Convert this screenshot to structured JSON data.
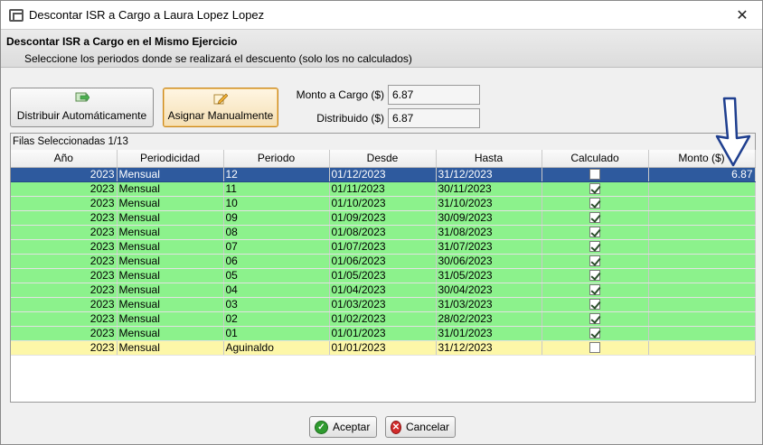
{
  "window": {
    "title": "Descontar ISR a Cargo a Laura Lopez Lopez",
    "close_glyph": "✕"
  },
  "header": {
    "title": "Descontar ISR a Cargo en el Mismo Ejercicio",
    "subtitle": "Seleccione los periodos donde se realizará el descuento (solo los no calculados)"
  },
  "toolbar": {
    "auto_label": "Distribuir Automáticamente",
    "manual_label": "Asignar Manualmente"
  },
  "fields": {
    "monto_label": "Monto a Cargo ($)",
    "monto_value": "6.87",
    "distribuido_label": "Distribuido ($)",
    "distribuido_value": "6.87"
  },
  "grid": {
    "caption": "Filas Seleccionadas  1/13",
    "columns": [
      "Año",
      "Periodicidad",
      "Periodo",
      "Desde",
      "Hasta",
      "Calculado",
      "Monto ($)"
    ],
    "rows": [
      {
        "anio": "2023",
        "periodicidad": "Mensual",
        "periodo": "12",
        "desde": "01/12/2023",
        "hasta": "31/12/2023",
        "calculado": false,
        "monto": "6.87",
        "state": "selected"
      },
      {
        "anio": "2023",
        "periodicidad": "Mensual",
        "periodo": "11",
        "desde": "01/11/2023",
        "hasta": "30/11/2023",
        "calculado": true,
        "monto": "",
        "state": "calculated"
      },
      {
        "anio": "2023",
        "periodicidad": "Mensual",
        "periodo": "10",
        "desde": "01/10/2023",
        "hasta": "31/10/2023",
        "calculado": true,
        "monto": "",
        "state": "calculated"
      },
      {
        "anio": "2023",
        "periodicidad": "Mensual",
        "periodo": "09",
        "desde": "01/09/2023",
        "hasta": "30/09/2023",
        "calculado": true,
        "monto": "",
        "state": "calculated"
      },
      {
        "anio": "2023",
        "periodicidad": "Mensual",
        "periodo": "08",
        "desde": "01/08/2023",
        "hasta": "31/08/2023",
        "calculado": true,
        "monto": "",
        "state": "calculated"
      },
      {
        "anio": "2023",
        "periodicidad": "Mensual",
        "periodo": "07",
        "desde": "01/07/2023",
        "hasta": "31/07/2023",
        "calculado": true,
        "monto": "",
        "state": "calculated"
      },
      {
        "anio": "2023",
        "periodicidad": "Mensual",
        "periodo": "06",
        "desde": "01/06/2023",
        "hasta": "30/06/2023",
        "calculado": true,
        "monto": "",
        "state": "calculated"
      },
      {
        "anio": "2023",
        "periodicidad": "Mensual",
        "periodo": "05",
        "desde": "01/05/2023",
        "hasta": "31/05/2023",
        "calculado": true,
        "monto": "",
        "state": "calculated"
      },
      {
        "anio": "2023",
        "periodicidad": "Mensual",
        "periodo": "04",
        "desde": "01/04/2023",
        "hasta": "30/04/2023",
        "calculado": true,
        "monto": "",
        "state": "calculated"
      },
      {
        "anio": "2023",
        "periodicidad": "Mensual",
        "periodo": "03",
        "desde": "01/03/2023",
        "hasta": "31/03/2023",
        "calculado": true,
        "monto": "",
        "state": "calculated"
      },
      {
        "anio": "2023",
        "periodicidad": "Mensual",
        "periodo": "02",
        "desde": "01/02/2023",
        "hasta": "28/02/2023",
        "calculado": true,
        "monto": "",
        "state": "calculated"
      },
      {
        "anio": "2023",
        "periodicidad": "Mensual",
        "periodo": "01",
        "desde": "01/01/2023",
        "hasta": "31/01/2023",
        "calculado": true,
        "monto": "",
        "state": "calculated"
      },
      {
        "anio": "2023",
        "periodicidad": "Mensual",
        "periodo": "Aguinaldo",
        "desde": "01/01/2023",
        "hasta": "31/12/2023",
        "calculado": false,
        "monto": "",
        "state": "pending"
      }
    ]
  },
  "footer": {
    "accept_label": "Aceptar",
    "cancel_label": "Cancelar"
  },
  "colors": {
    "selected_row": "#2e5a9e",
    "calculated_row": "#8cf28c",
    "pending_row": "#fdf7a8",
    "active_button": "#f5dfb3"
  },
  "icons": {
    "auto": "distribute-icon",
    "manual": "edit-pencil-icon",
    "accept": "check-circle-icon",
    "cancel": "x-circle-icon",
    "overlay": "down-arrow-annotation-icon"
  }
}
